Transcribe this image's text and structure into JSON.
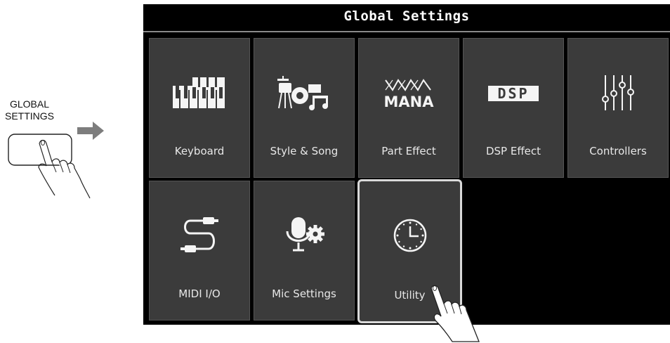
{
  "instruction": {
    "button_label_line1": "GLOBAL",
    "button_label_line2": "SETTINGS"
  },
  "screen": {
    "title": "Global Settings",
    "tiles": [
      {
        "label": "Keyboard",
        "icon": "keyboard-icon"
      },
      {
        "label": "Style & Song",
        "icon": "drums-note-icon"
      },
      {
        "label": "Part Effect",
        "icon": "mana-icon",
        "icon_text": "MANA"
      },
      {
        "label": "DSP Effect",
        "icon": "dsp-icon",
        "icon_text": "DSP"
      },
      {
        "label": "Controllers",
        "icon": "sliders-icon"
      },
      {
        "label": "MIDI I/O",
        "icon": "usb-cable-icon"
      },
      {
        "label": "Mic Settings",
        "icon": "mic-gear-icon"
      },
      {
        "label": "Utility",
        "icon": "clock-icon",
        "selected": true
      }
    ]
  },
  "colors": {
    "screen_bg": "#000000",
    "tile_bg": "#3b3b3b",
    "text": "#e8e8e8",
    "selected_border": "#d9d9d9"
  }
}
